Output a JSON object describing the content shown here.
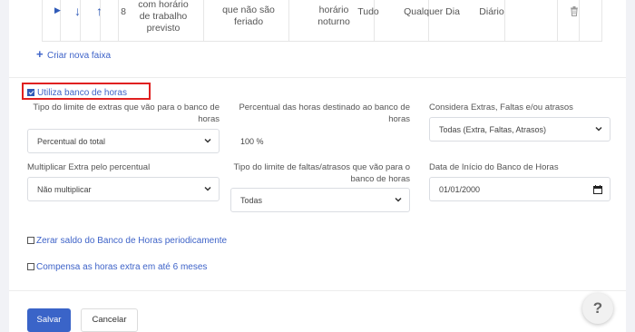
{
  "table_row": {
    "index": "8",
    "col1_lines": [
      "com horário",
      "de trabalho",
      "previsto"
    ],
    "col2_lines": [
      "que não são",
      "feriado"
    ],
    "col3_lines": [
      "horário",
      "noturno"
    ],
    "col4": "Tudo",
    "col5": "Qualquer Dia",
    "col6": "Diário"
  },
  "add_range_link": "Criar nova faixa",
  "use_bank_label": "Utiliza banco de horas",
  "fields": {
    "limit_type_label": "Tipo do limite de extras que vão para o banco de horas",
    "limit_type_value": "Percentual do total",
    "percent_label": "Percentual das horas destinado ao banco de horas",
    "percent_value": "100 %",
    "consider_label": "Considera Extras, Faltas e/ou atrasos",
    "consider_value": "Todas (Extra, Faltas, Atrasos)",
    "multiply_label": "Multiplicar Extra pelo percentual",
    "multiply_value": "Não multiplicar",
    "absence_limit_label": "Tipo do limite de faltas/atrasos que vão para o banco de horas",
    "absence_limit_value": "Todas",
    "start_date_label": "Data de Início do Banco de Horas",
    "start_date_value": "01/01/2000"
  },
  "reset_label": "Zerar saldo do Banco de Horas periodicamente",
  "compensate_label": "Compensa as horas extra em até 6 meses",
  "buttons": {
    "save": "Salvar",
    "cancel": "Cancelar"
  },
  "help_symbol": "?",
  "colors": {
    "primary": "#3a64c8",
    "highlight": "#e02020"
  }
}
